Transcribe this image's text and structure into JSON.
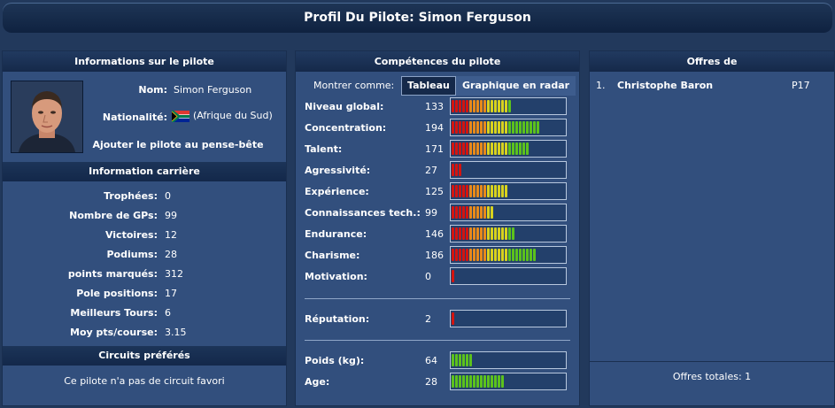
{
  "page_title": "Profil Du Pilote: Simon Ferguson",
  "left": {
    "header": "Informations sur le pilote",
    "name_label": "Nom:",
    "name_value": "Simon Ferguson",
    "nationality_label": "Nationalité:",
    "nationality_value": "(Afrique du Sud)",
    "add_link": "Ajouter le pilote au pense-bête",
    "career_header": "Information carrière",
    "career": [
      {
        "label": "Trophées:",
        "value": "0"
      },
      {
        "label": "Nombre de GPs:",
        "value": "99"
      },
      {
        "label": "Victoires:",
        "value": "12"
      },
      {
        "label": "Podiums:",
        "value": "28"
      },
      {
        "label": "points marqués:",
        "value": "312"
      },
      {
        "label": "Pole positions:",
        "value": "17"
      },
      {
        "label": "Meilleurs Tours:",
        "value": "6"
      },
      {
        "label": "Moy pts/course:",
        "value": "3.15"
      }
    ],
    "circuits_header": "Circuits préférés",
    "circuits_text": "Ce pilote n'a pas de circuit favori"
  },
  "mid": {
    "header": "Compétences du pilote",
    "show_as": "Montrer comme:",
    "tab_table": "Tableau",
    "tab_radar": "Graphique en radar",
    "skills": [
      {
        "label": "Niveau global:",
        "value": "133",
        "segs": 17,
        "kind": "rg"
      },
      {
        "label": "Concentration:",
        "value": "194",
        "segs": 25,
        "kind": "rg"
      },
      {
        "label": "Talent:",
        "value": "171",
        "segs": 22,
        "kind": "rg"
      },
      {
        "label": "Agressivité:",
        "value": "27",
        "segs": 3,
        "kind": "rg"
      },
      {
        "label": "Expérience:",
        "value": "125",
        "segs": 16,
        "kind": "rg"
      },
      {
        "label": "Connaissances tech.:",
        "value": "99",
        "segs": 12,
        "kind": "rg"
      },
      {
        "label": "Endurance:",
        "value": "146",
        "segs": 18,
        "kind": "rg"
      },
      {
        "label": "Charisme:",
        "value": "186",
        "segs": 24,
        "kind": "rg"
      },
      {
        "label": "Motivation:",
        "value": "0",
        "segs": 1,
        "kind": "rg"
      }
    ],
    "reputation": {
      "label": "Réputation:",
      "value": "2",
      "segs": 1,
      "kind": "rg"
    },
    "physical": [
      {
        "label": "Poids (kg):",
        "value": "64",
        "segs": 6,
        "kind": "g"
      },
      {
        "label": "Age:",
        "value": "28",
        "segs": 15,
        "kind": "g"
      }
    ]
  },
  "right": {
    "header": "Offres de",
    "offers": [
      {
        "rank": "1.",
        "name": "Christophe Baron",
        "code": "P17"
      }
    ],
    "total": "Offres totales: 1"
  },
  "colors": {
    "panel": "#324f7d",
    "header": "#15294a",
    "red": "#d4140f",
    "orange": "#e88a1a",
    "yellow": "#d8d21e",
    "green": "#5cc21c"
  },
  "icons": {
    "flag": "south-africa-flag-icon",
    "avatar": "driver-portrait"
  }
}
